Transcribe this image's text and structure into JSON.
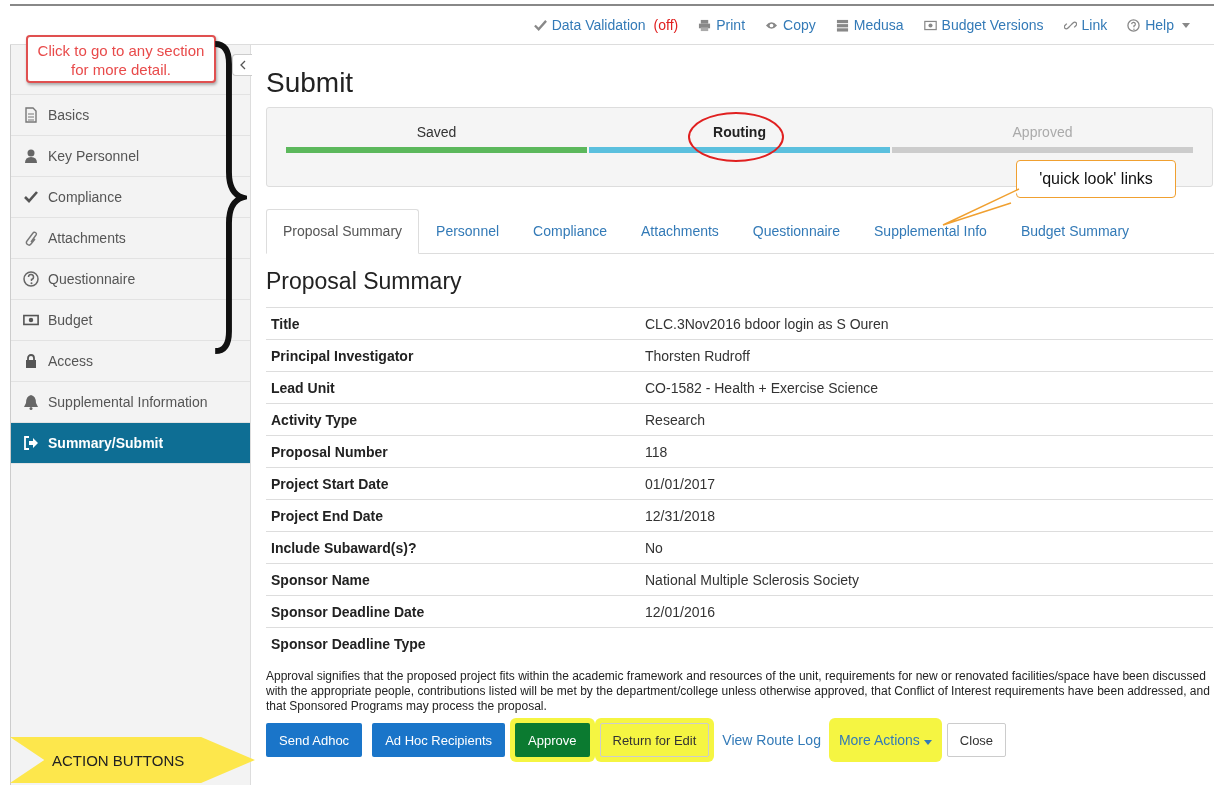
{
  "toolbar": [
    {
      "label": "Data Validation",
      "status": "(off)"
    },
    {
      "label": "Print"
    },
    {
      "label": "Copy"
    },
    {
      "label": "Medusa"
    },
    {
      "label": "Budget Versions"
    },
    {
      "label": "Link"
    },
    {
      "label": "Help",
      "dropdown": true
    }
  ],
  "callout": "Click to go to any section for more detail.",
  "sidebar": {
    "items": [
      {
        "label": "Basics",
        "selected": false
      },
      {
        "label": "Key Personnel",
        "selected": false
      },
      {
        "label": "Compliance",
        "selected": false
      },
      {
        "label": "Attachments",
        "selected": false
      },
      {
        "label": "Questionnaire",
        "selected": false
      },
      {
        "label": "Budget",
        "selected": false
      },
      {
        "label": "Access",
        "selected": false
      },
      {
        "label": "Supplemental Information",
        "selected": false
      },
      {
        "label": "Summary/Submit",
        "selected": true
      }
    ]
  },
  "page_title": "Submit",
  "progress": [
    {
      "label": "Saved",
      "selected": false,
      "reached": true,
      "color": "#5cb85c"
    },
    {
      "label": "Routing",
      "selected": true,
      "reached": true,
      "color": "#5bc0de",
      "circled": true
    },
    {
      "label": "Approved",
      "selected": false,
      "reached": false,
      "color": "#cccccc"
    }
  ],
  "quick_look_callout": "'quick look' links",
  "tabs": [
    {
      "label": "Proposal Summary",
      "selected": true
    },
    {
      "label": "Personnel",
      "selected": false
    },
    {
      "label": "Compliance",
      "selected": false
    },
    {
      "label": "Attachments",
      "selected": false
    },
    {
      "label": "Questionnaire",
      "selected": false
    },
    {
      "label": "Supplemental Info",
      "selected": false
    },
    {
      "label": "Budget Summary",
      "selected": false
    }
  ],
  "section_title": "Proposal Summary",
  "summary_rows": [
    {
      "label": "Title",
      "value": "CLC.3Nov2016 bdoor login as S Ouren"
    },
    {
      "label": "Principal Investigator",
      "value": "Thorsten Rudroff"
    },
    {
      "label": "Lead Unit",
      "value": "CO-1582 - Health + Exercise Science"
    },
    {
      "label": "Activity Type",
      "value": "Research"
    },
    {
      "label": "Proposal Number",
      "value": "118"
    },
    {
      "label": "Project Start Date",
      "value": "01/01/2017"
    },
    {
      "label": "Project End Date",
      "value": "12/31/2018"
    },
    {
      "label": "Include Subaward(s)?",
      "value": "No"
    },
    {
      "label": "Sponsor Name",
      "value": "National Multiple Sclerosis Society"
    },
    {
      "label": "Sponsor Deadline Date",
      "value": "12/01/2016"
    },
    {
      "label": "Sponsor Deadline Type"
    }
  ],
  "approval_text": "Approval signifies that the proposed project fits within the academic framework and resources of the unit, requirements for new or renovated facilities/space have been discussed with the appropriate people, contributions listed will be met by the department/college unless otherwise approved, that Conflict of Interest requirements have been addressed, and that Sponsored Programs may process the proposal.",
  "action_label": "ACTION BUTTONS",
  "actions": [
    {
      "label": "Send Adhoc",
      "kind": "primary",
      "highlighted": false
    },
    {
      "label": "Ad Hoc Recipients",
      "kind": "primary",
      "highlighted": false
    },
    {
      "label": "Approve",
      "kind": "success",
      "highlighted": true
    },
    {
      "label": "Return for Edit",
      "kind": "warning",
      "highlighted": true
    },
    {
      "label": "View Route Log",
      "kind": "link",
      "highlighted": false
    },
    {
      "label": "More Actions",
      "kind": "dropdown",
      "highlighted": true
    },
    {
      "label": "Close",
      "kind": "default",
      "highlighted": false
    }
  ]
}
